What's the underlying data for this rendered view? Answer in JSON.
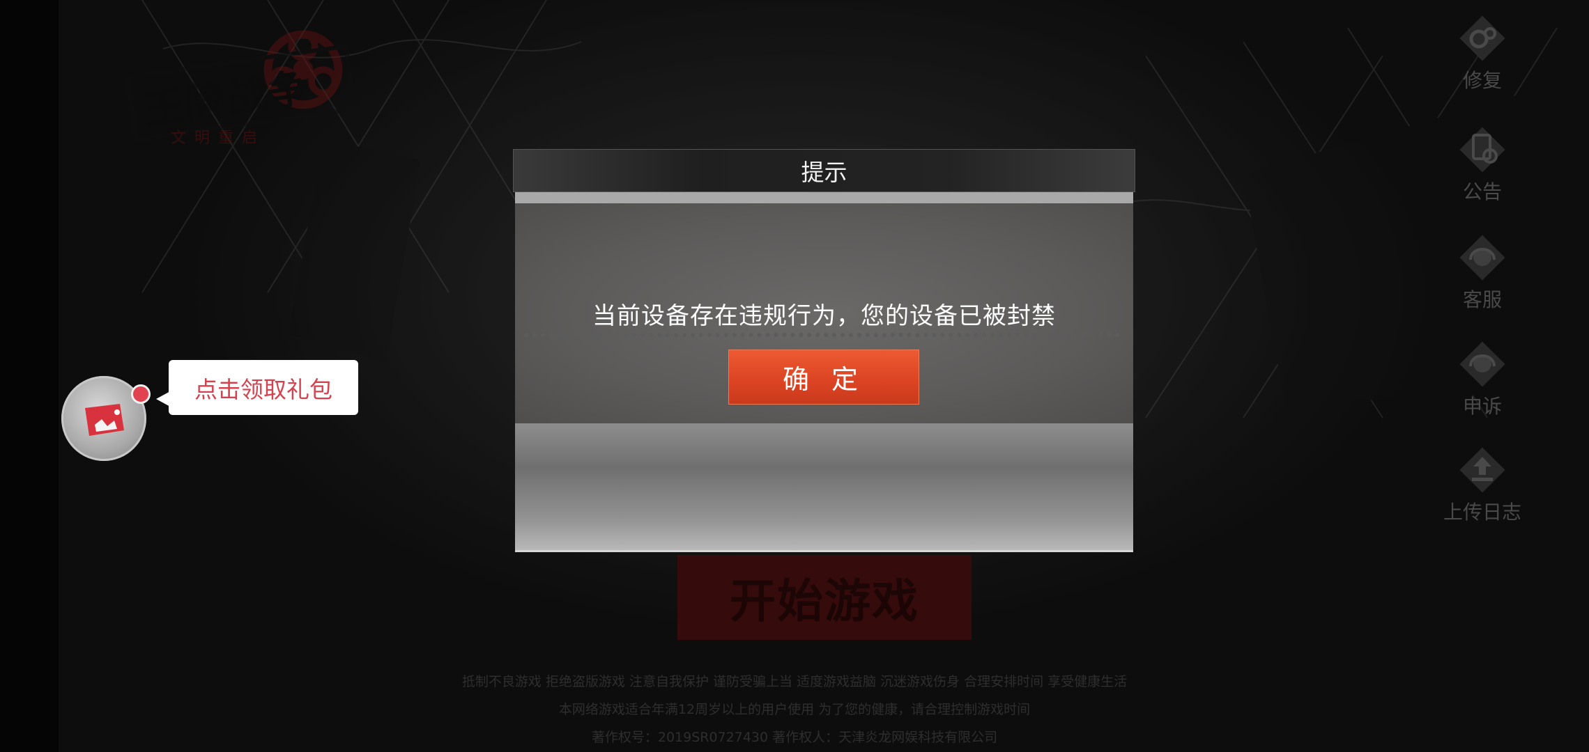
{
  "logo": {
    "title": "王牌战争",
    "subtitle": "文明重启"
  },
  "side_menu": [
    {
      "label": "修复",
      "icon": "gear-icon"
    },
    {
      "label": "公告",
      "icon": "notice-icon"
    },
    {
      "label": "客服",
      "icon": "headset-icon"
    },
    {
      "label": "申诉",
      "icon": "headset-icon"
    },
    {
      "label": "上传日志",
      "icon": "upload-icon"
    }
  ],
  "gift": {
    "bubble_text": "点击领取礼包"
  },
  "start_button": {
    "label": "开始游戏"
  },
  "footer": {
    "line1": "抵制不良游戏 拒绝盗版游戏 注意自我保护 谨防受骗上当 适度游戏益脑 沉迷游戏伤身 合理安排时间 享受健康生活",
    "line2": "本网络游戏适合年满12周岁以上的用户使用   为了您的健康，请合理控制游戏时间",
    "line3": "著作权号：2019SR0727430       著作权人：天津炎龙网娱科技有限公司"
  },
  "dialog": {
    "title": "提示",
    "message": "当前设备存在违规行为，您的设备已被封禁",
    "confirm_label": "确 定"
  },
  "colors": {
    "accent": "#db4322",
    "gift_text": "#d5424f"
  }
}
